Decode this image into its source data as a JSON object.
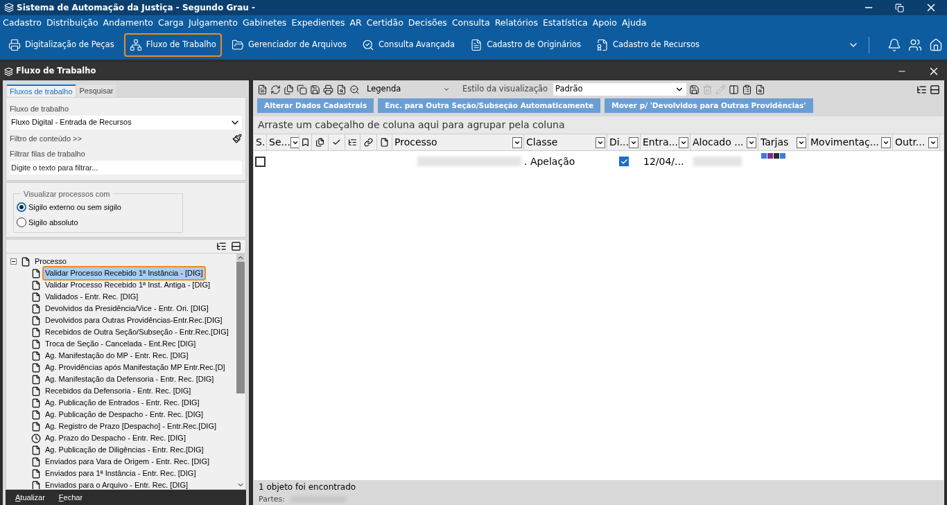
{
  "app_window": {
    "title": "Sistema de Automação da Justiça - Segundo Grau -"
  },
  "menu": [
    "Cadastro",
    "Distribuição",
    "Andamento",
    "Carga",
    "Julgamento",
    "Gabinetes",
    "Expedientes",
    "AR",
    "Certidão",
    "Decisões",
    "Consulta",
    "Relatórios",
    "Estatística",
    "Apoio",
    "Ajuda"
  ],
  "toolbar": [
    {
      "label": "Digitalização de Peças",
      "selected": false
    },
    {
      "label": "Fluxo de Trabalho",
      "selected": true
    },
    {
      "label": "Gerenciador de Arquivos",
      "selected": false
    },
    {
      "label": "Consulta Avançada",
      "selected": false
    },
    {
      "label": "Cadastro de Originários",
      "selected": false
    },
    {
      "label": "Cadastro de Recursos",
      "selected": false
    }
  ],
  "inner_window": {
    "title": "Fluxo de Trabalho"
  },
  "left_tabs": [
    {
      "label": "Fluxos de trabalho",
      "selected": true
    },
    {
      "label": "Pesquisar",
      "selected": false
    }
  ],
  "workflow": {
    "label": "Fluxo de trabalho",
    "value": "Fluxo Digital - Entrada de Recursos"
  },
  "content_filter": "Filtro de conteúdo >>",
  "queue_filter": {
    "label": "Filtrar filas de trabalho",
    "placeholder": "Digite o texto para filtrar..."
  },
  "view_group": {
    "legend": "Visualizar processos com",
    "options": [
      {
        "label": "Sigilo externo ou sem sigilo",
        "selected": true
      },
      {
        "label": "Sigilo absoluto",
        "selected": false
      }
    ]
  },
  "tree": {
    "label": "Processo",
    "expanded": true,
    "children": [
      {
        "label": "Validar Processo Recebido 1ª Instância - [DIG]",
        "selected": true,
        "kind": "queue"
      },
      {
        "label": "Validar Processo Recebido 1ª Inst. Antiga - [DIG]",
        "selected": false,
        "kind": "queue"
      },
      {
        "label": "Validados - Entr. Rec. [DIG]",
        "selected": false,
        "kind": "queue"
      },
      {
        "label": "Devolvidos da Presidência/Vice - Entr. Ori. [DIG]",
        "selected": false,
        "kind": "queue"
      },
      {
        "label": "Devolvidos para Outras Providências-Entr.Rec.[DIG]",
        "selected": false,
        "kind": "queue"
      },
      {
        "label": "Recebidos de Outra Seção/Subseção - Entr.Rec.[DIG]",
        "selected": false,
        "kind": "queue"
      },
      {
        "label": "Troca de Seção - Cancelada - Ent.Rec [DIG]",
        "selected": false,
        "kind": "queue"
      },
      {
        "label": "Ag. Manifestação do MP - Entr. Rec. [DIG]",
        "selected": false,
        "kind": "queue"
      },
      {
        "label": "Ag. Providências após Manifestação MP Entr.Rec.[D]",
        "selected": false,
        "kind": "queue"
      },
      {
        "label": "Ag. Manifestação da Defensoria - Entr. Rec. [DIG]",
        "selected": false,
        "kind": "queue"
      },
      {
        "label": "Recebidos da Defensoria - Entr. Rec. [DIG]",
        "selected": false,
        "kind": "queue"
      },
      {
        "label": "Ag. Publicação de Entrados - Entr. Rec. [DIG]",
        "selected": false,
        "kind": "queue"
      },
      {
        "label": "Ag. Publicação de Despacho - Entr. Rec. [DIG]",
        "selected": false,
        "kind": "queue"
      },
      {
        "label": "Ag. Registro de Prazo [Despacho] - Entr.Rec.[DIG]",
        "selected": false,
        "kind": "queue"
      },
      {
        "label": "Ag. Prazo do Despacho - Entr. Rec. [DIG]",
        "selected": false,
        "kind": "timer"
      },
      {
        "label": "Ag. Publicação de Diligências - Entr. Rec.[DIG]",
        "selected": false,
        "kind": "queue"
      },
      {
        "label": "Enviados para Vara de Origem - Entr. Rec. [DIG]",
        "selected": false,
        "kind": "queue"
      },
      {
        "label": "Enviados para 1ª Instância - Entr. Rec. [DIG]",
        "selected": false,
        "kind": "queue"
      },
      {
        "label": "Enviados para o Arquivo - Entr. Rec. [DIG]",
        "selected": false,
        "kind": "queue"
      }
    ]
  },
  "footer_buttons": [
    "Atualizar",
    "Fechar"
  ],
  "legend_value": "Legenda",
  "view_style": {
    "label": "Estilo da visualização",
    "value": "Padrão"
  },
  "action_buttons": [
    "Alterar Dados Cadastrais",
    "Enc. para Outra Seção/Subseção Automaticamente",
    "Mover p/ 'Devolvidos para Outras Providências'"
  ],
  "group_hint": "Arraste um cabeçalho de coluna aqui para agrupar pela coluna",
  "columns": [
    {
      "kind": "text",
      "label": "S."
    },
    {
      "kind": "text",
      "label": "Se..."
    },
    {
      "kind": "icon"
    },
    {
      "kind": "icon"
    },
    {
      "kind": "icon"
    },
    {
      "kind": "icon"
    },
    {
      "kind": "icon"
    },
    {
      "kind": "icon"
    },
    {
      "kind": "text",
      "label": "Processo"
    },
    {
      "kind": "text",
      "label": "Classe"
    },
    {
      "kind": "text",
      "label": "Di..."
    },
    {
      "kind": "text",
      "label": "Entra..."
    },
    {
      "kind": "text",
      "label": "Alocado ..."
    },
    {
      "kind": "text",
      "label": "Tarjas"
    },
    {
      "kind": "text",
      "label": "Movimentaç..."
    },
    {
      "kind": "text",
      "label": "Outr..."
    }
  ],
  "rows": [
    {
      "checked": false,
      "classe": ". Apelação",
      "digital": true,
      "entrada": "12/04/...",
      "tarjas": [
        {
          "color": "#3b7dd8"
        },
        {
          "color": "#7b2f8e"
        },
        {
          "color": "#2b2b2b"
        },
        {
          "color": "#3b7dd8"
        }
      ]
    }
  ],
  "status": "1 objeto foi encontrado",
  "partes_label": "Partes:"
}
